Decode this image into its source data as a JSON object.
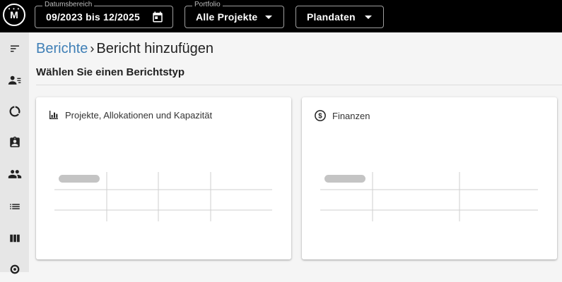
{
  "header": {
    "logo_text": "M",
    "date_range": {
      "label": "Datumsbereich",
      "value": "09/2023 bis 12/2025",
      "icon": "calendar-icon"
    },
    "portfolio": {
      "label": "Portfolio",
      "value": "Alle Projekte",
      "icon": "caret-down-icon"
    },
    "data_type": {
      "value": "Plandaten",
      "icon": "caret-down-icon"
    }
  },
  "sidebar": {
    "items": [
      {
        "icon": "sort-list-icon"
      },
      {
        "icon": "people-list-icon"
      },
      {
        "icon": "donut-chart-icon"
      },
      {
        "icon": "clipboard-user-icon"
      },
      {
        "icon": "group-icon"
      },
      {
        "icon": "list-icon"
      },
      {
        "icon": "columns-icon"
      },
      {
        "icon": "settings-icon"
      }
    ]
  },
  "breadcrumb": {
    "link": "Berichte",
    "separator": "›",
    "current": "Bericht hinzufügen"
  },
  "section_title": "Wählen Sie einen Berichtstyp",
  "cards": [
    {
      "title": "Projekte, Allokationen und Kapazität",
      "icon": "bar-chart-icon"
    },
    {
      "title": "Finanzen",
      "icon": "dollar-circle-icon"
    }
  ],
  "colors": {
    "topbar": "#000000",
    "link": "#3f7fb6",
    "sidebar": "#e6e6e6",
    "background": "#f5f5f5"
  }
}
